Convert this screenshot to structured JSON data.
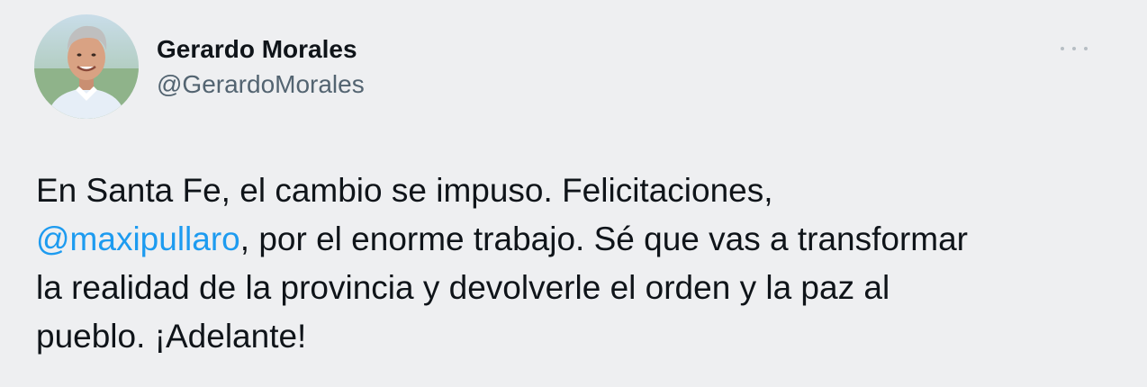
{
  "author": {
    "display_name": "Gerardo Morales",
    "handle": "@GerardoMorales"
  },
  "icons": {
    "more": "more-options-icon",
    "avatar": "profile-photo"
  },
  "colors": {
    "background": "#eeeff1",
    "text": "#0f1419",
    "secondary_text": "#536471",
    "mention": "#1d9bf0"
  },
  "tweet": {
    "line1": "En Santa Fe, el cambio se impuso. Felicitaciones,",
    "mention": "@maxipullaro",
    "line2_rest": ", por el enorme trabajo. Sé que vas a transformar",
    "line3": "la realidad de la provincia y devolverle el orden y la paz al",
    "line4": "pueblo. ¡Adelante!"
  }
}
